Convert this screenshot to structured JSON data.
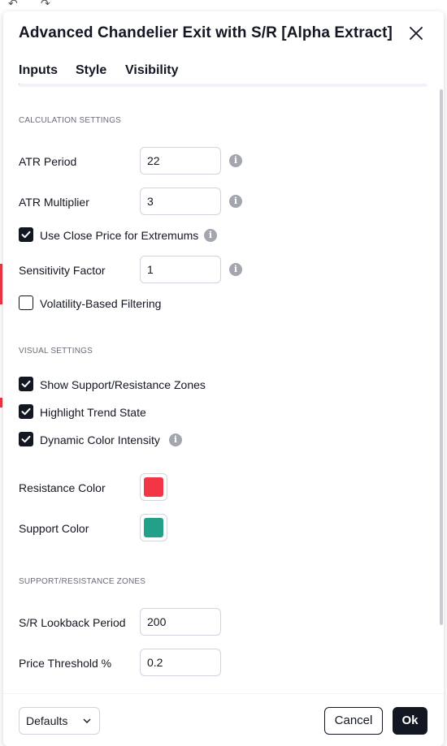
{
  "dialog": {
    "title": "Advanced Chandelier Exit with S/R [Alpha Extract]"
  },
  "tabs": [
    {
      "label": "Inputs",
      "active": true
    },
    {
      "label": "Style",
      "active": false
    },
    {
      "label": "Visibility",
      "active": false
    }
  ],
  "sections": {
    "calculation": "CALCULATION SETTINGS",
    "visual": "VISUAL SETTINGS",
    "sr_zones": "SUPPORT/RESISTANCE ZONES"
  },
  "inputs": {
    "atr_period": {
      "label": "ATR Period",
      "value": "22"
    },
    "atr_multiplier": {
      "label": "ATR Multiplier",
      "value": "3"
    },
    "sensitivity_factor": {
      "label": "Sensitivity Factor",
      "value": "1"
    },
    "sr_lookback": {
      "label": "S/R Lookback Period",
      "value": "200"
    },
    "price_threshold": {
      "label": "Price Threshold %",
      "value": "0.2"
    }
  },
  "checkboxes": {
    "use_close_price": {
      "label": "Use Close Price for Extremums",
      "checked": true
    },
    "volatility_filtering": {
      "label": "Volatility-Based Filtering",
      "checked": false
    },
    "show_sr_zones": {
      "label": "Show Support/Resistance Zones",
      "checked": true
    },
    "highlight_trend": {
      "label": "Highlight Trend State",
      "checked": true
    },
    "dynamic_color": {
      "label": "Dynamic Color Intensity",
      "checked": true
    }
  },
  "colors": {
    "resistance": {
      "label": "Resistance Color",
      "value": "#f23645"
    },
    "support": {
      "label": "Support Color",
      "value": "#22a08a"
    }
  },
  "footer": {
    "defaults_label": "Defaults",
    "cancel_label": "Cancel",
    "ok_label": "Ok"
  }
}
